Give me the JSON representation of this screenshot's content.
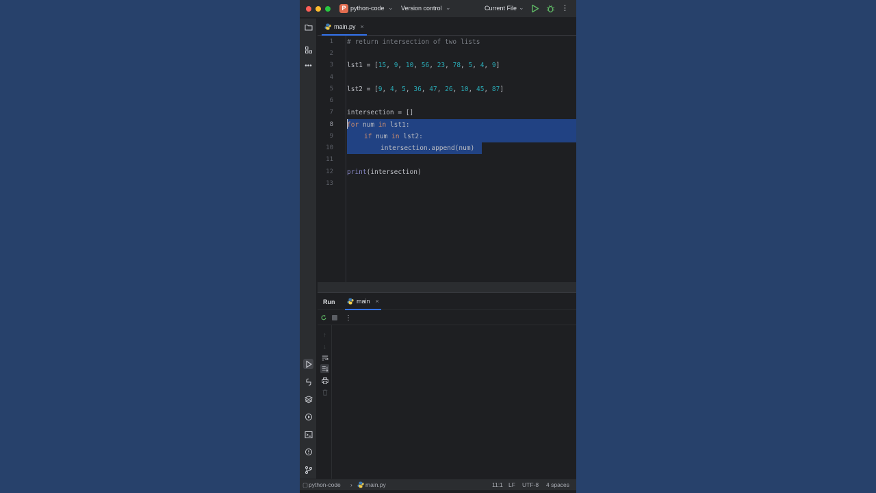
{
  "titlebar": {
    "project_initial": "P",
    "project_name": "python-code",
    "vcs": "Version control",
    "run_config": "Current File",
    "more_glyph": "⋮"
  },
  "left_strip": {
    "icons": [
      "folder-icon",
      "structure-icon",
      "more-tools-icon",
      "run-tool-icon",
      "python-packages-icon",
      "layers-icon",
      "services-icon",
      "terminal-icon",
      "problems-icon",
      "git-icon"
    ]
  },
  "editor": {
    "tab_label": "main.py",
    "close_glyph": "×",
    "line_numbers": [
      "1",
      "2",
      "3",
      "4",
      "5",
      "6",
      "7",
      "8",
      "9",
      "10",
      "11",
      "12",
      "13"
    ],
    "current_line": "8"
  },
  "code": {
    "comment": "# return intersection of two lists",
    "lst1_name": "lst1",
    "lst1_values": [
      "15",
      "9",
      "10",
      "56",
      "23",
      "78",
      "5",
      "4",
      "9"
    ],
    "lst2_name": "lst2",
    "lst2_values": [
      "9",
      "4",
      "5",
      "36",
      "47",
      "26",
      "10",
      "45",
      "87"
    ],
    "intersection_line": "intersection = []",
    "for_kw": "for",
    "for_rest": " num ",
    "in_kw": "in",
    "for_tail": " lst1:",
    "if_kw": "if",
    "if_rest": " num ",
    "if_tail": " lst2:",
    "append_line": "intersection.append(num)",
    "print_fn": "print",
    "print_args": "(intersection)"
  },
  "run_panel": {
    "title": "Run",
    "tab_label": "main",
    "close_glyph": "×"
  },
  "statusbar": {
    "project": "python-code",
    "sep": "›",
    "file": "main.py",
    "position": "11:1",
    "line_sep": "LF",
    "encoding": "UTF-8",
    "indent": "4 spaces"
  },
  "colors": {
    "background": "#27416b",
    "selection": "#214283",
    "keyword": "#cf8e6d",
    "number": "#2aacb8",
    "builtin": "#8888c6",
    "accent": "#3574f0"
  }
}
